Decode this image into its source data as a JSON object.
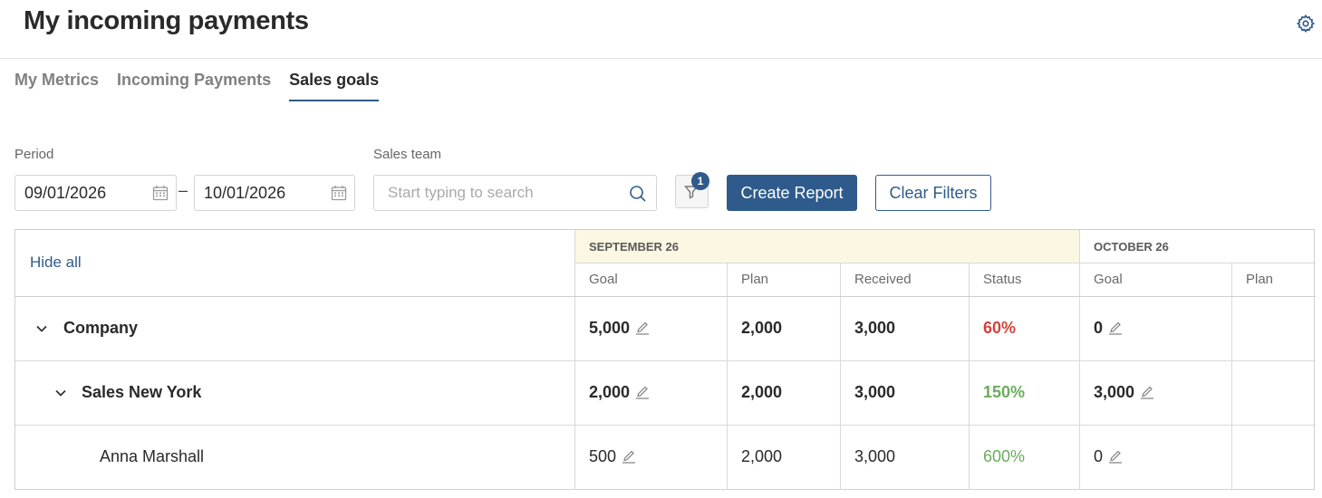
{
  "header": {
    "title": "My incoming payments"
  },
  "tabs": [
    {
      "label": "My Metrics",
      "active": false
    },
    {
      "label": "Incoming Payments",
      "active": false
    },
    {
      "label": "Sales goals",
      "active": true
    }
  ],
  "filters": {
    "period_label": "Period",
    "date_from": "09/01/2026",
    "date_separator": "–",
    "date_to": "10/01/2026",
    "sales_team_label": "Sales team",
    "search_placeholder": "Start typing to search",
    "filter_count": "1",
    "create_report_label": "Create Report",
    "clear_filters_label": "Clear Filters"
  },
  "table": {
    "hide_all_label": "Hide all",
    "months": [
      {
        "label": "SEPTEMBER 26",
        "columns": [
          "Goal",
          "Plan",
          "Received",
          "Status"
        ]
      },
      {
        "label": "OCTOBER 26",
        "columns": [
          "Goal",
          "Plan"
        ]
      }
    ],
    "rows": [
      {
        "name": "Company",
        "level": 0,
        "expanded": true,
        "sep_goal": "5,000",
        "sep_plan": "2,000",
        "sep_received": "3,000",
        "sep_status": "60%",
        "status_color": "#d0443c",
        "oct_goal": "0",
        "oct_plan": ""
      },
      {
        "name": "Sales New York",
        "level": 1,
        "expanded": true,
        "sep_goal": "2,000",
        "sep_plan": "2,000",
        "sep_received": "3,000",
        "sep_status": "150%",
        "status_color": "#6aac5c",
        "oct_goal": "3,000",
        "oct_plan": ""
      },
      {
        "name": "Anna Marshall",
        "level": 2,
        "expanded": false,
        "sep_goal": "500",
        "sep_plan": "2,000",
        "sep_received": "3,000",
        "sep_status": "600%",
        "status_color": "#6aac5c",
        "oct_goal": "0",
        "oct_plan": ""
      }
    ]
  },
  "colors": {
    "accent": "#2f5b8c",
    "highlight_month": "#fbf7e2"
  },
  "icons": {
    "settings": "gear-icon",
    "calendar": "calendar-icon",
    "search": "search-icon",
    "filter": "filter-icon",
    "edit": "pencil-icon",
    "expand": "chevron-down-icon"
  }
}
